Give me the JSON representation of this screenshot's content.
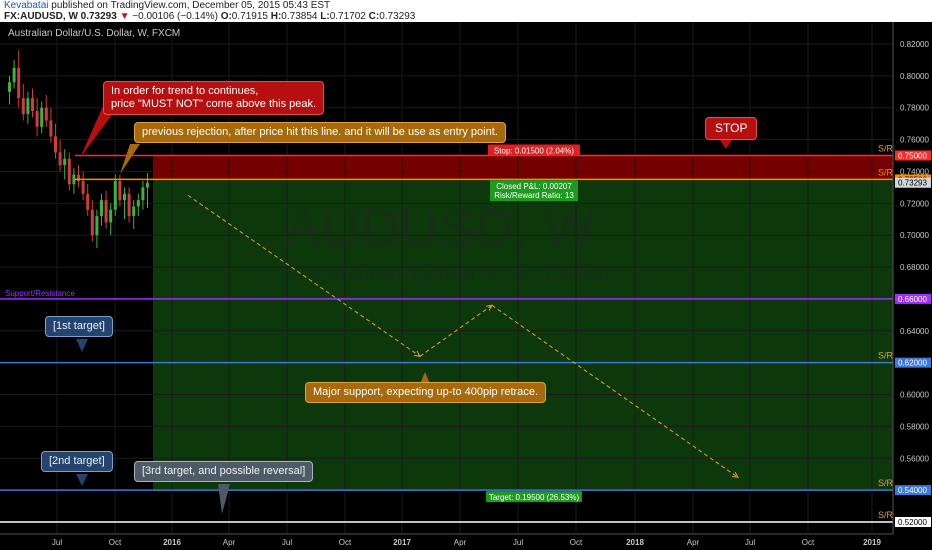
{
  "header": {
    "author": "Kevabatai",
    "published_text": " published on TradingView.com, December 05, 2015 05:43 EST",
    "symbol_line": "FX:AUDUSD, W  0.73293",
    "down_arrow": "▼",
    "change_text": "−0.00106 (−0.14%)",
    "ohlc": [
      {
        "label": "O:",
        "value": "0.71915"
      },
      {
        "label": "H:",
        "value": "0.73854"
      },
      {
        "label": "L:",
        "value": "0.71702"
      },
      {
        "label": "C:",
        "value": "0.73293"
      }
    ]
  },
  "colors": {
    "background": "#000000",
    "grid": "#1a1a1a",
    "axis_text": "#c8c8c8",
    "candle_up": "#3cb43c",
    "candle_down": "#d23c3c",
    "stop_line": "#ff2a2a",
    "entry_line": "#ff8c00",
    "support_line": "#9b30ff",
    "target_line": "#3c78d8",
    "white_line": "#ffffff",
    "zone_red": "#8a0000",
    "zone_green": "#0d3e0d",
    "arrow": "#f0a020"
  },
  "chart_data": {
    "type": "candlestick",
    "title": "Australian Dollar/U.S. Dollar, W, FXCM",
    "watermark": "AUDUSD, W",
    "watermark_sub": "Australian Dollar/U.S. Dollar",
    "x_tick_labels": [
      "Jul",
      "Oct",
      "2016",
      "Apr",
      "Jul",
      "Oct",
      "2017",
      "Apr",
      "Jul",
      "Oct",
      "2018",
      "Apr",
      "Jul",
      "Oct",
      "2019"
    ],
    "y_range": [
      0.512,
      0.83
    ],
    "y_ticks": [
      {
        "value": 0.82,
        "label": "0.82000"
      },
      {
        "value": 0.8,
        "label": "0.80000"
      },
      {
        "value": 0.78,
        "label": "0.78000"
      },
      {
        "value": 0.76,
        "label": "0.76000"
      },
      {
        "value": 0.74,
        "label": "0.74000"
      },
      {
        "value": 0.72,
        "label": "0.72000"
      },
      {
        "value": 0.7,
        "label": "0.70000"
      },
      {
        "value": 0.68,
        "label": "0.68000"
      },
      {
        "value": 0.64,
        "label": "0.64000"
      },
      {
        "value": 0.6,
        "label": "0.60000"
      },
      {
        "value": 0.58,
        "label": "0.58000"
      },
      {
        "value": 0.56,
        "label": "0.56000"
      },
      {
        "value": 0.52,
        "label": "0.52000"
      }
    ],
    "price_badges": [
      {
        "value": 0.75,
        "label": "0.75000",
        "color": "#ff2a2a",
        "text": "#ffffff"
      },
      {
        "value": 0.735,
        "label": "0.73500",
        "color": "#ff8c00",
        "text": "#000000"
      },
      {
        "value": 0.73293,
        "label": "0.73293",
        "color": "#cfd6dc",
        "text": "#000000"
      },
      {
        "value": 0.66,
        "label": "0.66000",
        "color": "#9b30ff",
        "text": "#ffffff"
      },
      {
        "value": 0.62,
        "label": "0.62000",
        "color": "#3c78d8",
        "text": "#ffffff"
      },
      {
        "value": 0.54,
        "label": "0.54000",
        "color": "#3c78d8",
        "text": "#ffffff"
      },
      {
        "value": 0.52,
        "label": "0.52000",
        "color": "#ffffff",
        "text": "#000000"
      }
    ],
    "candles": [
      {
        "o": 0.79,
        "h": 0.8,
        "l": 0.782,
        "c": 0.796
      },
      {
        "o": 0.796,
        "h": 0.81,
        "l": 0.792,
        "c": 0.805
      },
      {
        "o": 0.805,
        "h": 0.816,
        "l": 0.78,
        "c": 0.786
      },
      {
        "o": 0.786,
        "h": 0.795,
        "l": 0.772,
        "c": 0.776
      },
      {
        "o": 0.776,
        "h": 0.79,
        "l": 0.77,
        "c": 0.786
      },
      {
        "o": 0.786,
        "h": 0.792,
        "l": 0.774,
        "c": 0.778
      },
      {
        "o": 0.778,
        "h": 0.786,
        "l": 0.762,
        "c": 0.768
      },
      {
        "o": 0.768,
        "h": 0.784,
        "l": 0.764,
        "c": 0.78
      },
      {
        "o": 0.78,
        "h": 0.788,
        "l": 0.768,
        "c": 0.772
      },
      {
        "o": 0.772,
        "h": 0.78,
        "l": 0.758,
        "c": 0.762
      },
      {
        "o": 0.762,
        "h": 0.77,
        "l": 0.748,
        "c": 0.752
      },
      {
        "o": 0.752,
        "h": 0.76,
        "l": 0.74,
        "c": 0.744
      },
      {
        "o": 0.744,
        "h": 0.754,
        "l": 0.735,
        "c": 0.748
      },
      {
        "o": 0.748,
        "h": 0.752,
        "l": 0.728,
        "c": 0.732
      },
      {
        "o": 0.732,
        "h": 0.742,
        "l": 0.726,
        "c": 0.738
      },
      {
        "o": 0.738,
        "h": 0.744,
        "l": 0.73,
        "c": 0.734
      },
      {
        "o": 0.734,
        "h": 0.74,
        "l": 0.722,
        "c": 0.726
      },
      {
        "o": 0.726,
        "h": 0.732,
        "l": 0.712,
        "c": 0.716
      },
      {
        "o": 0.716,
        "h": 0.722,
        "l": 0.696,
        "c": 0.7
      },
      {
        "o": 0.7,
        "h": 0.716,
        "l": 0.692,
        "c": 0.712
      },
      {
        "o": 0.712,
        "h": 0.726,
        "l": 0.706,
        "c": 0.722
      },
      {
        "o": 0.722,
        "h": 0.728,
        "l": 0.704,
        "c": 0.708
      },
      {
        "o": 0.708,
        "h": 0.72,
        "l": 0.7,
        "c": 0.716
      },
      {
        "o": 0.716,
        "h": 0.738,
        "l": 0.712,
        "c": 0.734
      },
      {
        "o": 0.734,
        "h": 0.738,
        "l": 0.718,
        "c": 0.722
      },
      {
        "o": 0.722,
        "h": 0.73,
        "l": 0.71,
        "c": 0.726
      },
      {
        "o": 0.726,
        "h": 0.73,
        "l": 0.708,
        "c": 0.712
      },
      {
        "o": 0.712,
        "h": 0.722,
        "l": 0.704,
        "c": 0.718
      },
      {
        "o": 0.718,
        "h": 0.726,
        "l": 0.712,
        "c": 0.722
      },
      {
        "o": 0.722,
        "h": 0.734,
        "l": 0.716,
        "c": 0.73
      },
      {
        "o": 0.73,
        "h": 0.739,
        "l": 0.717,
        "c": 0.733
      }
    ],
    "levels": {
      "stop": 0.75,
      "entry": 0.735,
      "support": 0.66,
      "target1": 0.62,
      "target2": 0.54,
      "target3": 0.52
    },
    "sr_label": "S/R",
    "support_label": "Support/Resistance",
    "position": {
      "stop_label": "Stop: 0.01500 (2.04%)",
      "pnl_label": "Closed P&L: 0.00207",
      "ratio_label": "Risk/Reward Ratio: 13",
      "target_label": "Target: 0.19500 (26.53%)"
    },
    "projection_path": [
      {
        "x": "Dec 2015",
        "y": 0.725
      },
      {
        "x": "Feb 2017",
        "y": 0.624
      },
      {
        "x": "Jun 2017",
        "y": 0.656
      },
      {
        "x": "Aug 2018",
        "y": 0.548
      }
    ]
  },
  "annotations": {
    "must_not": "In order for trend to continues,\nprice \"MUST NOT\" come above this peak.",
    "rejection": "previous rejection, after price hit this line. and it will be use as entry point.",
    "stop": "STOP",
    "target1": "[1st target]",
    "major_support": "Major support, expecting up-to 400pip retrace.",
    "target2": "[2nd target]",
    "target3": "[3rd target, and possible reversal]"
  }
}
